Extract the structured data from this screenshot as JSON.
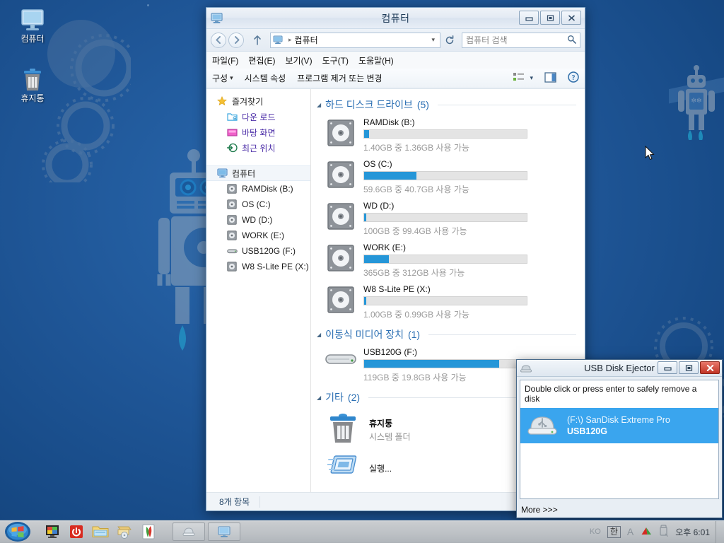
{
  "desktop": {
    "icons": [
      {
        "name": "컴퓨터",
        "icon": "computer-icon"
      },
      {
        "name": "휴지통",
        "icon": "recycle-bin-icon"
      }
    ]
  },
  "explorer": {
    "title": "컴퓨터",
    "window_buttons": {
      "minimize": "minimize-icon",
      "maximize": "maximize-icon",
      "close": "close-icon"
    },
    "nav": {
      "back": "back-arrow-icon",
      "forward": "forward-arrow-icon",
      "up": "up-arrow-icon",
      "address_root": "컴퓨터",
      "address_separator": "▸",
      "dropdown": "chevron-down-icon",
      "refresh": "refresh-icon",
      "search_placeholder": "컴퓨터 검색",
      "search_icon": "search-icon"
    },
    "menu": [
      "파일(F)",
      "편집(E)",
      "보기(V)",
      "도구(T)",
      "도움말(H)"
    ],
    "commandbar": {
      "organize": "구성",
      "organize_caret": "▾",
      "system_properties": "시스템 속성",
      "uninstall_or_change": "프로그램 제거 또는 변경",
      "view_icon": "view-layout-icon",
      "view_caret": "▾",
      "preview_pane_icon": "preview-pane-icon",
      "help_icon": "help-icon"
    },
    "sidebar": {
      "favorites": {
        "label": "즐겨찾기",
        "icon": "star-icon"
      },
      "favorite_items": [
        {
          "label": "다운 로드",
          "icon": "downloads-folder-icon"
        },
        {
          "label": "바탕 화면",
          "icon": "desktop-icon"
        },
        {
          "label": "최근 위치",
          "icon": "recent-places-icon"
        }
      ],
      "computer": {
        "label": "컴퓨터",
        "icon": "computer-icon"
      },
      "drives": [
        {
          "label": "RAMDisk (B:)",
          "icon": "hard-drive-icon"
        },
        {
          "label": "OS (C:)",
          "icon": "hard-drive-icon"
        },
        {
          "label": "WD (D:)",
          "icon": "hard-drive-icon"
        },
        {
          "label": "WORK (E:)",
          "icon": "hard-drive-icon"
        },
        {
          "label": "USB120G (F:)",
          "icon": "removable-drive-icon"
        },
        {
          "label": "W8 S-Lite PE (X:)",
          "icon": "hard-drive-icon"
        }
      ]
    },
    "groups": {
      "hard_disks": {
        "title": "하드 디스크 드라이브",
        "count": "(5)"
      },
      "removable": {
        "title": "이동식 미디어 장치",
        "count": "(1)"
      },
      "other": {
        "title": "기타",
        "count": "(2)"
      }
    },
    "hard_drives": [
      {
        "name": "RAMDisk (B:)",
        "detail": "1.40GB 중 1.36GB 사용 가능",
        "used_percent": 3,
        "bar_color": "#2596d8"
      },
      {
        "name": "OS (C:)",
        "detail": "59.6GB 중 40.7GB 사용 가능",
        "used_percent": 32,
        "bar_color": "#2596d8"
      },
      {
        "name": "WD (D:)",
        "detail": "100GB 중 99.4GB 사용 가능",
        "used_percent": 1,
        "bar_color": "#2596d8"
      },
      {
        "name": "WORK (E:)",
        "detail": "365GB 중 312GB 사용 가능",
        "used_percent": 15,
        "bar_color": "#2596d8"
      },
      {
        "name": "W8 S-Lite PE (X:)",
        "detail": "1.00GB 중 0.99GB 사용 가능",
        "used_percent": 1,
        "bar_color": "#2596d8"
      }
    ],
    "removable_drives": [
      {
        "name": "USB120G (F:)",
        "detail": "119GB 중 19.8GB 사용 가능",
        "used_percent": 83,
        "bar_color": "#2596d8"
      }
    ],
    "other_items": [
      {
        "name": "휴지통",
        "detail": "시스템 폴더",
        "icon": "recycle-bin-icon"
      },
      {
        "name": "실행...",
        "detail": "",
        "icon": "run-icon"
      }
    ],
    "status": "8개 항목"
  },
  "ejector": {
    "title": "USB Disk Ejector",
    "icon": "usb-disk-icon",
    "window_buttons": {
      "minimize": "minimize-icon",
      "maximize": "maximize-icon",
      "close": "close-icon"
    },
    "hint": "Double click or press enter to safely remove a disk",
    "devices": [
      {
        "path": "(F:\\) SanDisk Extreme Pro",
        "label": "USB120G",
        "icon": "usb-stick-icon",
        "selected": true
      }
    ],
    "more": "More >>>",
    "selection_color": "#3aa5ee"
  },
  "taskbar": {
    "start": "start-orb-icon",
    "quicklaunch": [
      {
        "icon": "display-settings-icon"
      },
      {
        "icon": "power-button-icon"
      },
      {
        "icon": "explorer-folder-icon"
      },
      {
        "icon": "disc-burner-icon"
      },
      {
        "icon": "paint-icon"
      }
    ],
    "tasks": [
      {
        "icon": "usb-disk-icon"
      },
      {
        "icon": "computer-icon"
      }
    ],
    "tray": {
      "ime_lang": "KO",
      "ime_mode": "한",
      "ime_shape": "A",
      "icons": [
        "nvidia-icon",
        "usb-eject-icon"
      ],
      "clock": "오후 6:01"
    }
  }
}
